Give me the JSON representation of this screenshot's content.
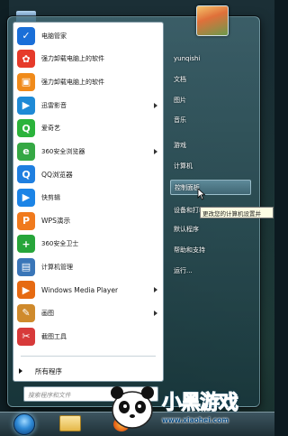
{
  "programs": [
    {
      "label": "电脑管家",
      "icon": "tencent-pc-manager-icon",
      "color": "#1a6fd8",
      "glyph": "✓",
      "has_submenu": false
    },
    {
      "label": "强力卸载电脑上的软件",
      "icon": "uninstall-pinwheel-icon",
      "color": "#e63a2a",
      "glyph": "✿",
      "has_submenu": false
    },
    {
      "label": "强力卸载电脑上的软件",
      "icon": "uninstall-box-icon",
      "color": "#f08a1a",
      "glyph": "▣",
      "has_submenu": false
    },
    {
      "label": "迅雷影音",
      "icon": "xunlei-player-icon",
      "color": "#1e8ad6",
      "glyph": "▶",
      "has_submenu": true
    },
    {
      "label": "爱奇艺",
      "icon": "iqiyi-icon",
      "color": "#2bb33b",
      "glyph": "Q",
      "has_submenu": false
    },
    {
      "label": "360安全浏览器",
      "icon": "360-browser-icon",
      "color": "#35a844",
      "glyph": "e",
      "has_submenu": true
    },
    {
      "label": "QQ浏览器",
      "icon": "qq-browser-icon",
      "color": "#1f7fe0",
      "glyph": "Q",
      "has_submenu": false
    },
    {
      "label": "快剪辑",
      "icon": "quick-edit-icon",
      "color": "#1c84e6",
      "glyph": "▶",
      "has_submenu": false
    },
    {
      "label": "WPS演示",
      "icon": "wps-presentation-icon",
      "color": "#f07a1d",
      "glyph": "P",
      "has_submenu": false
    },
    {
      "label": "360安全卫士",
      "icon": "360-security-icon",
      "color": "#27a53a",
      "glyph": "+",
      "has_submenu": false
    },
    {
      "label": "计算机管理",
      "icon": "computer-management-icon",
      "color": "#3a76b8",
      "glyph": "▤",
      "has_submenu": false
    },
    {
      "label": "Windows Media Player",
      "icon": "windows-media-player-icon",
      "color": "#e66a12",
      "glyph": "▶",
      "has_submenu": true
    },
    {
      "label": "画图",
      "icon": "paint-icon",
      "color": "#cf8a2c",
      "glyph": "✎",
      "has_submenu": true
    },
    {
      "label": "截图工具",
      "icon": "snipping-tool-icon",
      "color": "#d73a3a",
      "glyph": "✂",
      "has_submenu": false
    }
  ],
  "all_programs_label": "所有程序",
  "search": {
    "placeholder": "搜索程序和文件"
  },
  "right_items": [
    {
      "label": "yunqishi",
      "hover": false
    },
    {
      "label": "文档",
      "hover": false
    },
    {
      "label": "图片",
      "hover": false
    },
    {
      "label": "音乐",
      "hover": false
    },
    {
      "label": "游戏",
      "hover": false
    },
    {
      "label": "计算机",
      "hover": false
    },
    {
      "label": "控制面板",
      "hover": true
    },
    {
      "label": "设备和打印机",
      "hover": false
    },
    {
      "label": "默认程序",
      "hover": false
    },
    {
      "label": "帮助和支持",
      "hover": false
    },
    {
      "label": "运行...",
      "hover": false
    }
  ],
  "tooltip": "更改您的计算机设置并",
  "watermark": {
    "title": "小黑游戏",
    "url": "www.xiaohei.com"
  }
}
